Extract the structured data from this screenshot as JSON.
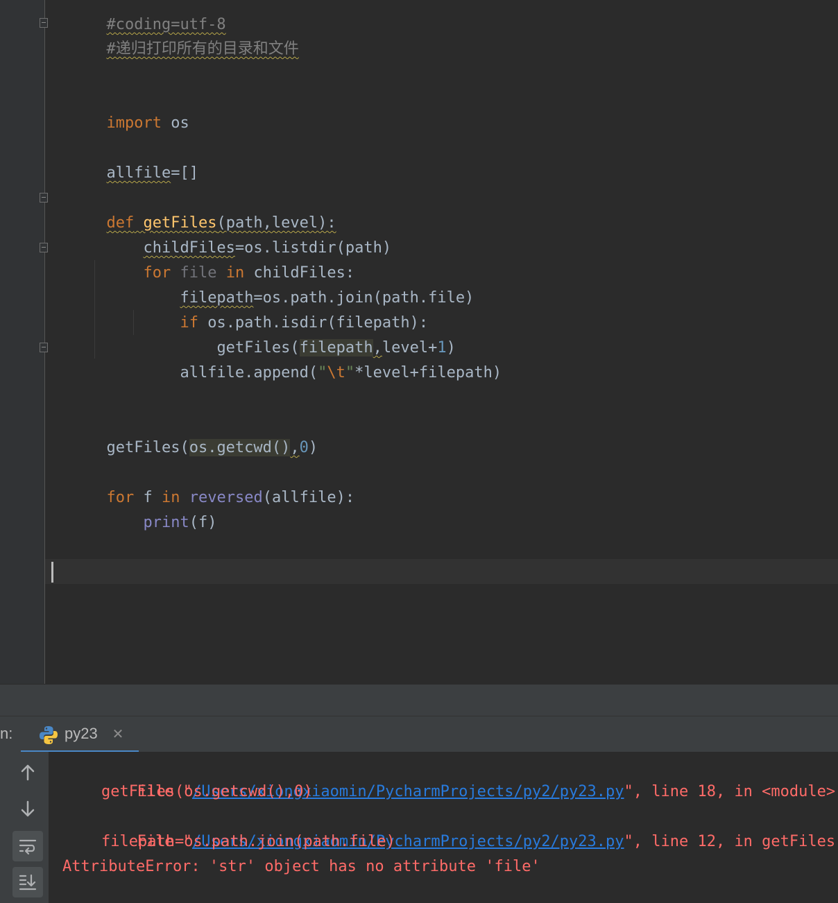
{
  "editor": {
    "lines": {
      "coding": "#coding=utf-8",
      "comment": "#递归打印所有的目录和文件",
      "import_kw": "import",
      "import_mod": " os",
      "allfile_name": "allfile",
      "allfile_rest": "=[]",
      "def_kw": "def",
      "def_name": "getFiles",
      "def_params": "(path,level):",
      "child_name": "childFiles",
      "child_rest": "=os.listdir(path)",
      "for1_kw": "for",
      "for1_var": "file",
      "for1_in": "in",
      "for1_rest": " childFiles:",
      "fp_name": "filepath",
      "fp_rest": "=os.path.join(path.file)",
      "if_kw": "if",
      "if_rest": " os.path.isdir(filepath):",
      "rec_call": "getFiles(",
      "rec_arg": "filepath",
      "rec_comma": ",",
      "rec_level": "level+",
      "rec_num": "1",
      "rec_close": ")",
      "append_call": "allfile.append(",
      "append_q1": "\"",
      "append_esc": "\\t",
      "append_q2": "\"",
      "append_rest": "*level+filepath)",
      "main_call": "getFiles(",
      "main_arg": "os.getcwd()",
      "main_comma": ",",
      "main_num": "0",
      "main_close": ")",
      "for2_kw": "for",
      "for2_var": " f ",
      "for2_in": "in",
      "for2_sp": " ",
      "for2_bi": "reversed",
      "for2_rest": "(allfile):",
      "print_bi": "print",
      "print_rest": "(f)"
    }
  },
  "run": {
    "label": "n:",
    "tab_label": "py23",
    "tab_icon": "python-icon",
    "close_glyph": "✕",
    "toolbar": [
      "arrow-up-icon",
      "arrow-down-icon",
      "soft-wrap-icon",
      "scroll-to-end-icon"
    ]
  },
  "console": {
    "l1_prefix": "File \"",
    "l1_link": "/Users/xiongxiaomin/PycharmProjects/py2/py23.py",
    "l1_suffix": "\", line 18, in <module>",
    "l2": "getFiles(os.getcwd(),0)",
    "l3_prefix": "File \"",
    "l3_link": "/Users/xiongxiaomin/PycharmProjects/py2/py23.py",
    "l3_suffix": "\", line 12, in getFiles",
    "l4": "filepath=os.path.join(path.file)",
    "l5": "AttributeError: 'str' object has no attribute 'file'"
  },
  "colors": {
    "editor_bg": "#2b2b2b",
    "keyword": "#cc7832",
    "function": "#ffc66d",
    "builtin": "#8888c6",
    "number": "#6897bb",
    "string": "#6a8759",
    "error": "#ff6b68",
    "link": "#287bde",
    "tab_accent": "#4a88c7"
  }
}
